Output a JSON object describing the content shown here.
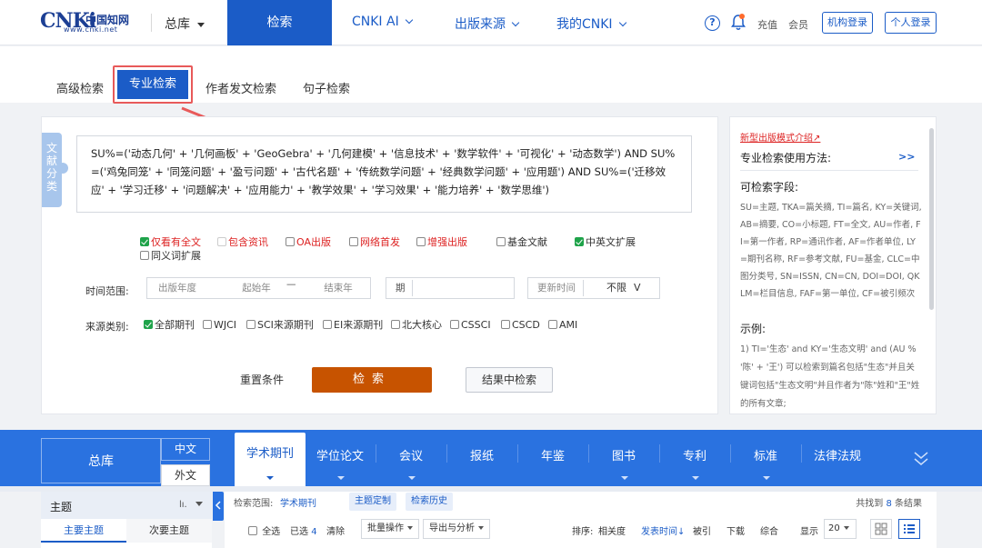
{
  "topnav": {
    "logo_mark": "CNKi",
    "logo_cn": "中国知网",
    "logo_url": "www.cnki.net",
    "zongku": "总库",
    "active": "检索",
    "items": [
      "CNKI AI",
      "出版来源",
      "我的CNKI"
    ],
    "help": "?",
    "charge": "充值",
    "member": "会员",
    "org_login": "机构登录",
    "personal_login": "个人登录"
  },
  "search_tabs": {
    "advanced": "高级检索",
    "professional": "专业检索",
    "author": "作者发文检索",
    "sentence": "句子检索"
  },
  "panel": {
    "side_tab": "文献分类",
    "expression": "SU%=('动态几何' + '几何画板' + 'GeoGebra' + '几何建模' + '信息技术' + '数学软件' + '可视化' + '动态数学') AND SU%=('鸡兔同笼' + '同笼问题' + '盈亏问题' + '古代名题' + '传统数学问题' + '经典数学问题' + '应用题') AND SU%=('迁移效应' + '学习迁移' + '问题解决' + '应用能力' + '教学效果' + '学习效果' + '能力培养' + '数学思维')",
    "filters": [
      {
        "label": "仅看有全文",
        "checked": true,
        "style": "red"
      },
      {
        "label": "包含资讯",
        "checked": false,
        "style": "gray"
      },
      {
        "label": "OA出版",
        "checked": false,
        "style": "red"
      },
      {
        "label": "网络首发",
        "checked": false,
        "style": "red"
      },
      {
        "label": "增强出版",
        "checked": false,
        "style": "red"
      },
      {
        "label": "基金文献",
        "checked": false,
        "style": "normal"
      },
      {
        "label": "中英文扩展",
        "checked": true,
        "style": "normal"
      },
      {
        "label": "同义词扩展",
        "checked": false,
        "style": "normal"
      }
    ],
    "time_label": "时间范围:",
    "pub_year": "出版年度",
    "start_year": "起始年",
    "dash": "—",
    "end_year": "结束年",
    "period": "期",
    "update_time": "更新时间",
    "update_value": "不限",
    "update_chev": "V",
    "source_label": "来源类别:",
    "sources": [
      {
        "label": "全部期刊",
        "checked": true
      },
      {
        "label": "WJCI",
        "checked": false
      },
      {
        "label": "SCI来源期刊",
        "checked": false
      },
      {
        "label": "EI来源期刊",
        "checked": false
      },
      {
        "label": "北大核心",
        "checked": false
      },
      {
        "label": "CSSCI",
        "checked": false
      },
      {
        "label": "CSCD",
        "checked": false
      },
      {
        "label": "AMI",
        "checked": false
      }
    ],
    "reset": "重置条件",
    "search": "检索",
    "in_results": "结果中检索"
  },
  "help": {
    "new_model": "新型出版模式介绍↗",
    "usage_title": "专业检索使用方法:",
    "more": ">>",
    "fields_title": "可检索字段:",
    "fields_text": "SU=主题, TKA=篇关摘, TI=篇名, KY=关键词, AB=摘要, CO=小标题, FT=全文, AU=作者, FI=第一作者, RP=通讯作者, AF=作者单位, LY=期刊名称, RF=参考文献, FU=基金, CLC=中图分类号, SN=ISSN, CN=CN, DOI=DOI, QKLM=栏目信息, FAF=第一单位, CF=被引频次",
    "example_title": "示例:",
    "example_text": "1) TI='生态' and KY='生态文明' and (AU % '陈' + '王') 可以检索到篇名包括\"生态\"并且关键词包括\"生态文明\"并且作者为\"陈\"姓和\"王\"姓的所有文章;"
  },
  "dbbar": {
    "zongku": "总库",
    "cn": "中文",
    "foreign": "外文",
    "active": "学术期刊",
    "tabs": [
      "学位论文",
      "会议",
      "报纸",
      "年鉴",
      "图书",
      "专利",
      "标准",
      "法律法规"
    ]
  },
  "results": {
    "topic": "主题",
    "topic_icon": "lı.",
    "main_topic": "主要主题",
    "sub_topic": "次要主题",
    "scope_label": "检索范围:",
    "scope_value": "学术期刊",
    "topic_custom": "主题定制",
    "history": "检索历史",
    "found_prefix": "共找到",
    "found_count": "8",
    "found_suffix": "条结果",
    "select_all": "全选",
    "selected_label": "已选",
    "selected_count": "4",
    "clear": "清除",
    "batch": "批量操作",
    "export": "导出与分析",
    "sort_label": "排序:",
    "sort_relevance": "相关度",
    "sort_date": "发表时间↓",
    "sort_cited": "被引",
    "sort_download": "下载",
    "sort_overall": "综合",
    "display_label": "显示",
    "display_value": "20"
  },
  "colors": {
    "brand_blue": "#1b5cc7",
    "search_orange": "#c75300",
    "highlight_red": "#e85a5a"
  }
}
